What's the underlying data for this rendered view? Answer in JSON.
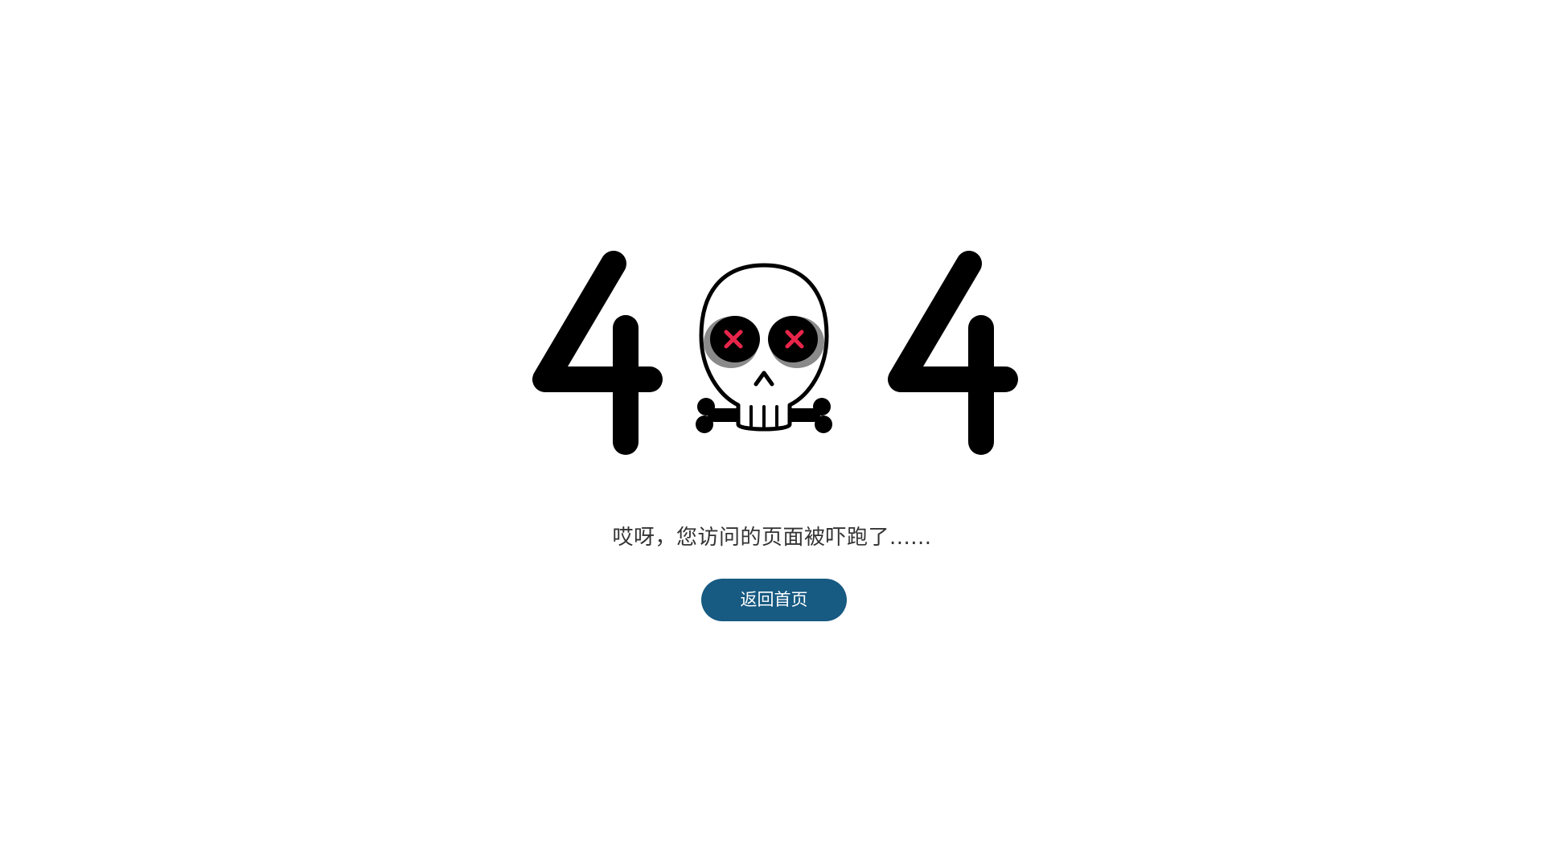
{
  "error_page": {
    "code_digits": [
      "4",
      "4"
    ],
    "illustration_icon": "skull-crossbones-icon",
    "message": "哎呀，您访问的页面被吓跑了......",
    "home_button_label": "返回首页"
  },
  "colors": {
    "background": "#ffffff",
    "ink": "#000000",
    "eye_x": "#e8254a",
    "eye_shadow": "#8a8a8a",
    "button": "#175a82",
    "button_text": "#ffffff",
    "message_text": "#333333"
  }
}
